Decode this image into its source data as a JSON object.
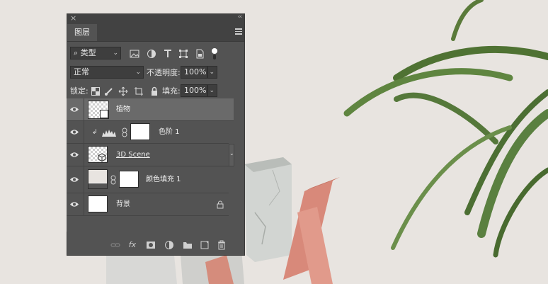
{
  "panel": {
    "close_glyph": "×",
    "collapse_glyph": "‹‹",
    "tab_label": "图层",
    "filter": {
      "glyph": "⌕",
      "value": "类型"
    },
    "blend_mode": "正常",
    "opacity_label": "不透明度:",
    "opacity_value": "100%",
    "lock_label": "锁定:",
    "fill_label": "填充:",
    "fill_value": "100%"
  },
  "layers": [
    {
      "name": "植物",
      "selected": true
    },
    {
      "name": "色阶 1",
      "clip_glyph": "↲"
    },
    {
      "name": "3D Scene"
    },
    {
      "name": "颜色填充 1"
    },
    {
      "name": "背景"
    }
  ],
  "footer": {
    "fx_label": "fx"
  }
}
